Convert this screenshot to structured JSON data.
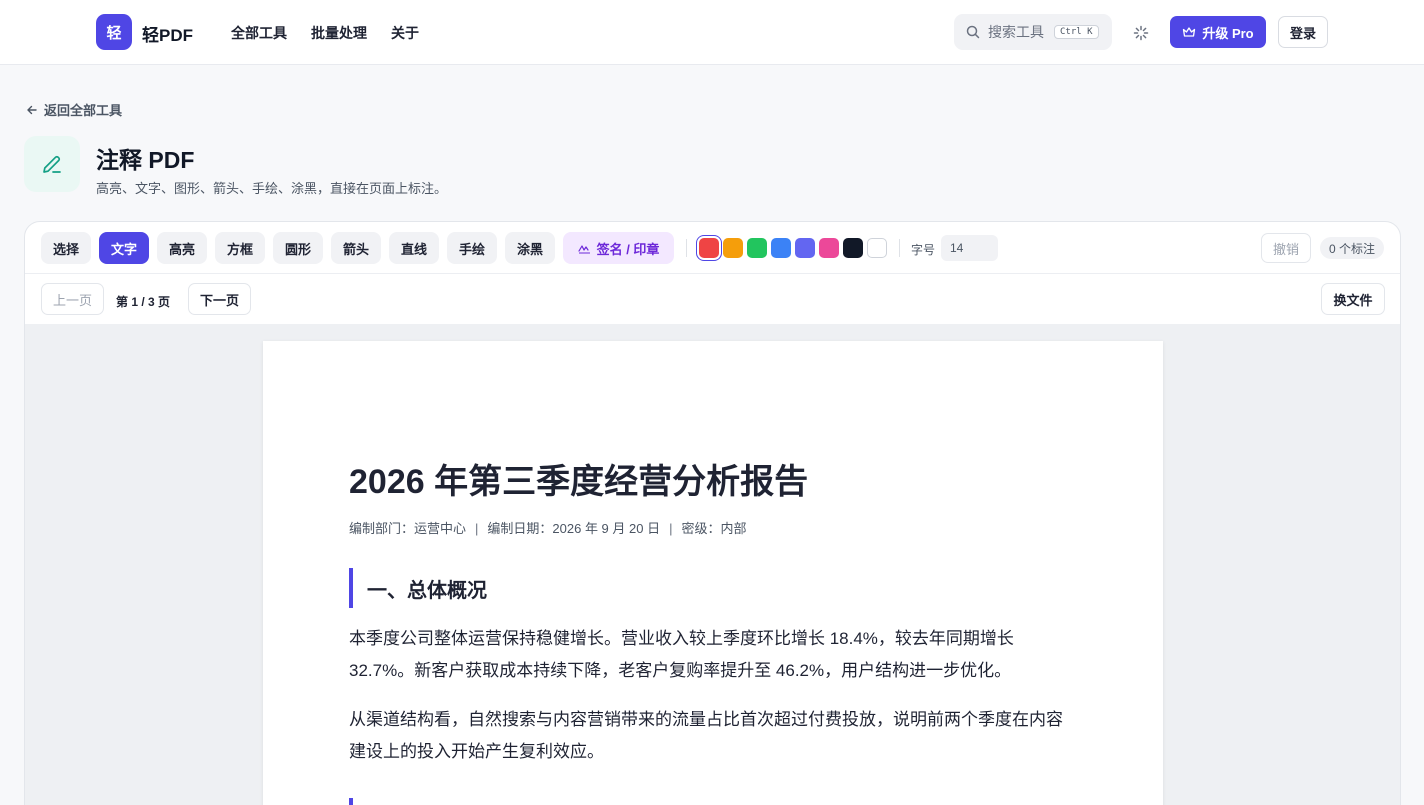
{
  "header": {
    "logo_char": "轻",
    "brand": "轻PDF",
    "nav": [
      "全部工具",
      "批量处理",
      "关于"
    ],
    "search_placeholder": "搜索工具",
    "search_shortcut": "Ctrl K",
    "pro_label": "升级 Pro",
    "login_label": "登录"
  },
  "page": {
    "back_label": "返回全部工具",
    "title": "注释 PDF",
    "subtitle": "高亮、文字、图形、箭头、手绘、涂黑，直接在页面上标注。"
  },
  "toolbar": {
    "tools": [
      "选择",
      "文字",
      "高亮",
      "方框",
      "圆形",
      "箭头",
      "直线",
      "手绘",
      "涂黑"
    ],
    "active_tool": "文字",
    "sign_label": "签名 / 印章",
    "colors": [
      "#ef4444",
      "#f59e0b",
      "#22c55e",
      "#3b82f6",
      "#6366f1",
      "#ec4899",
      "#111827",
      "#ffffff"
    ],
    "selected_color": "#ef4444",
    "font_size_label": "字号",
    "font_size_value": "14",
    "undo_label": "撤销",
    "annotation_count": "0 个标注"
  },
  "pager": {
    "prev_label": "上一页",
    "page_info": "第 1 / 3 页",
    "next_label": "下一页",
    "change_file_label": "换文件"
  },
  "document": {
    "title": "2026 年第三季度经营分析报告",
    "meta_dept": "编制部门：运营中心",
    "meta_date": "编制日期：2026 年 9 月 20 日",
    "meta_level": "密级：内部",
    "meta_sep": "|",
    "section1_heading": "一、总体概况",
    "para1": "本季度公司整体运营保持稳健增长。营业收入较上季度环比增长 18.4%，较去年同期增长 32.7%。新客户获取成本持续下降，老客户复购率提升至 46.2%，用户结构进一步优化。",
    "para2": "从渠道结构看，自然搜索与内容营销带来的流量占比首次超过付费投放，说明前两个季度在内容建设上的投入开始产生复利效应。"
  }
}
